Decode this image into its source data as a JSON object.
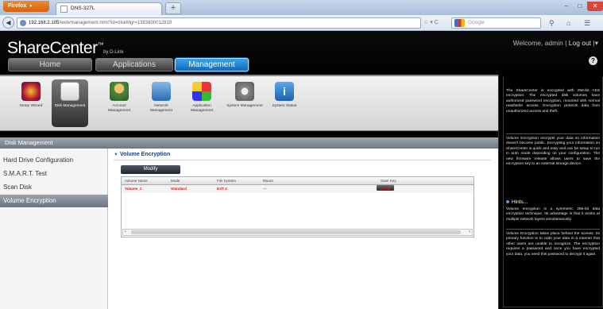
{
  "browser": {
    "menu_label": "Firefox",
    "tab_title": "DNS-327L",
    "new_tab": "+",
    "url_host": "192.168.2.105",
    "url_rest": "/web/management.html?id=diskMgr=1393800012819",
    "search_placeholder": "Google",
    "window_controls": [
      "–",
      "□",
      "✕"
    ]
  },
  "app": {
    "brand": "ShareCenter",
    "brand_by": "by D-Link",
    "welcome_text": "Welcome, admin |",
    "logout_label": "Log out",
    "help_label": "?",
    "nav_tabs": [
      "Home",
      "Applications",
      "Management"
    ]
  },
  "toolbar": {
    "items": [
      {
        "label": "Setup Wizard",
        "icon": "wand-icon"
      },
      {
        "label": "Disk Management",
        "icon": "disk-icon"
      },
      {
        "label": "Account Management",
        "icon": "user-icon"
      },
      {
        "label": "Network Management",
        "icon": "network-icon"
      },
      {
        "label": "Application Management",
        "icon": "apps-icon"
      },
      {
        "label": "System Management",
        "icon": "gear-icon"
      },
      {
        "label": "System Status",
        "icon": "info-icon"
      }
    ]
  },
  "left": {
    "header": "Disk Management",
    "items": [
      "Hard Drive Configuration",
      "S.M.A.R.T. Test",
      "Scan Disk",
      "Volume Encryption"
    ]
  },
  "content": {
    "section_title": "Volume Encryption",
    "modify_label": "Modify",
    "columns": [
      "Volume Name",
      "Mode",
      "File System",
      "Mount",
      "Save Key"
    ],
    "rows": [
      {
        "volume": "Volume_1",
        "mode": "Standard",
        "fs": "EXT 4",
        "mount": "---",
        "save": "SAVE"
      }
    ]
  },
  "info": {
    "p1": "The ShareCenter is encrypted with 256-bit AES encryption. The encrypted disk volumes have authorized password encryption, mounted with normal read/write access. Encryption protects data from unauthorized access and theft.",
    "p2": "Volume Encryption encrypts your data so information doesn't become public. Encrypting your information on ShareCenter is quick and easy and can be setup to run in auto mode depending on your configuration. The new firmware release allows users to save the encryption key to an external storage device.",
    "hints_title": "Hints...",
    "p3": "Volume encryption is a symmetric 256-bit data encryption technique. Its advantage is that it works at multiple network layers simultaneously.",
    "p4": "Volume Encryption takes place behind the scenes. Its primary function is to code your data in a manner that other users are unable to recognize. The encryption requires a password and once you have encrypted your data, you need this password to decrypt it again."
  }
}
